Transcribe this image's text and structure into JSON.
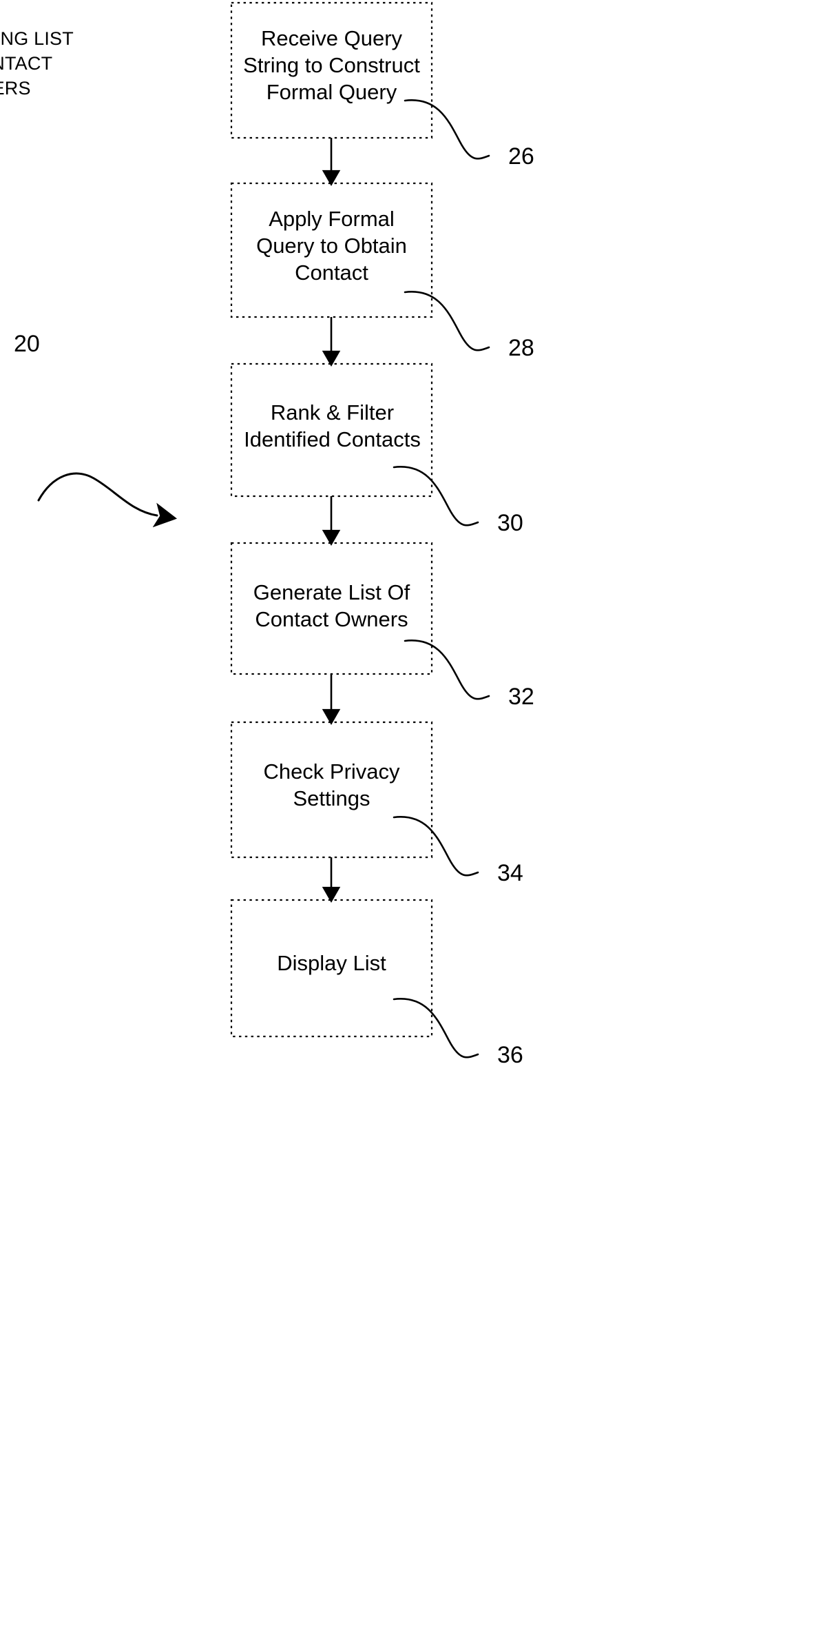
{
  "figure": {
    "title_lines": "ERATING LIST\nF CONTACT\nOWNERS",
    "title_full_visible": "ERATING LIST F CONTACT OWNERS",
    "system_ref": "20"
  },
  "flow": {
    "steps": [
      {
        "id": "step-26",
        "text": "Receive Query\nString to Construct\nFormal Query",
        "ref": "26"
      },
      {
        "id": "step-28",
        "text": "Apply Formal\nQuery to Obtain\nContact",
        "ref": "28"
      },
      {
        "id": "step-30",
        "text": "Rank & Filter\nIdentified Contacts",
        "ref": "30"
      },
      {
        "id": "step-32",
        "text": "Generate List Of\nContact Owners",
        "ref": "32"
      },
      {
        "id": "step-34",
        "text": "Check Privacy\nSettings",
        "ref": "34"
      },
      {
        "id": "step-36",
        "text": "Display List",
        "ref": "36"
      }
    ]
  },
  "style": {
    "stroke": "#000000",
    "background": "#ffffff"
  }
}
